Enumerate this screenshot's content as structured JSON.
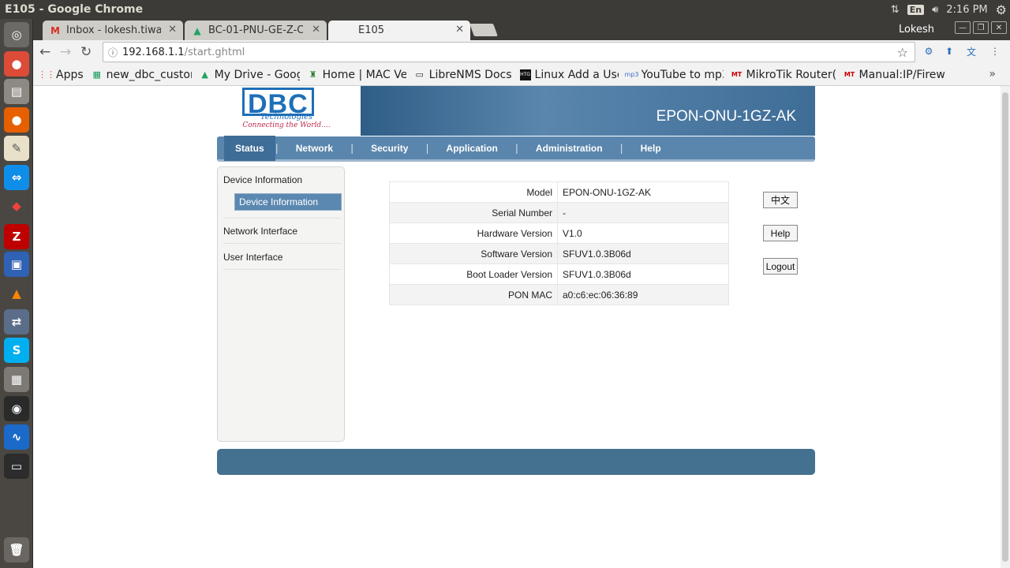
{
  "os": {
    "window_title": "E105 - Google Chrome",
    "keyboard": "En",
    "clock": "2:16 PM"
  },
  "launcher": {
    "icons": [
      "dash-icon",
      "chrome-icon",
      "files-icon",
      "firefox-icon",
      "text-editor-icon",
      "teamviewer-icon",
      "anydesk-icon",
      "filezilla-icon",
      "virtualbox-icon",
      "vlc-icon",
      "network-tool-icon",
      "skype-icon",
      "calculator-icon",
      "obs-icon",
      "wireshark-icon",
      "terminal-icon",
      "trash-icon"
    ]
  },
  "tabs": [
    {
      "label": "Inbox - lokesh.tiwa",
      "icon": "gmail-icon"
    },
    {
      "label": "BC-01-PNU-GE-Z-C_",
      "icon": "drive-icon"
    },
    {
      "label": "E105",
      "icon": ""
    }
  ],
  "profile": "Lokesh",
  "address": {
    "host": "192.168.1.1",
    "path": "/start.ghtml"
  },
  "bookmarks": [
    {
      "label": "Apps",
      "icon": "apps-icon"
    },
    {
      "label": "new_dbc_custon",
      "icon": "sheets-icon"
    },
    {
      "label": "My Drive - Google",
      "icon": "drive-icon"
    },
    {
      "label": "Home | MAC Venc",
      "icon": "mac-vendor-icon"
    },
    {
      "label": "LibreNMS Docs",
      "icon": "docs-icon"
    },
    {
      "label": "Linux Add a User",
      "icon": "htg-icon"
    },
    {
      "label": "YouTube to mp3",
      "icon": "mp3-icon"
    },
    {
      "label": "MikroTik Router(",
      "icon": "mikrotik-icon"
    },
    {
      "label": "Manual:IP/Firewa",
      "icon": "mikrotik-icon"
    }
  ],
  "router": {
    "brand_logo": "DBC",
    "brand_sub": "Technologies",
    "brand_tagline": "Connecting the World....",
    "device_title": "EPON-ONU-1GZ-AK",
    "menu": [
      "Status",
      "Network",
      "Security",
      "Application",
      "Administration",
      "Help"
    ],
    "sidebar": {
      "section1": "Device Information",
      "active_sub": "Device Information",
      "section2": "Network Interface",
      "section3": "User Interface"
    },
    "info": [
      {
        "label": "Model",
        "value": "EPON-ONU-1GZ-AK"
      },
      {
        "label": "Serial Number",
        "value": "-"
      },
      {
        "label": "Hardware Version",
        "value": "V1.0"
      },
      {
        "label": "Software Version",
        "value": "SFUV1.0.3B06d"
      },
      {
        "label": "Boot Loader Version",
        "value": "SFUV1.0.3B06d"
      },
      {
        "label": "PON MAC",
        "value": "a0:c6:ec:06:36:89"
      }
    ],
    "buttons": {
      "lang": "中文",
      "help": "Help",
      "logout": "Logout"
    }
  }
}
